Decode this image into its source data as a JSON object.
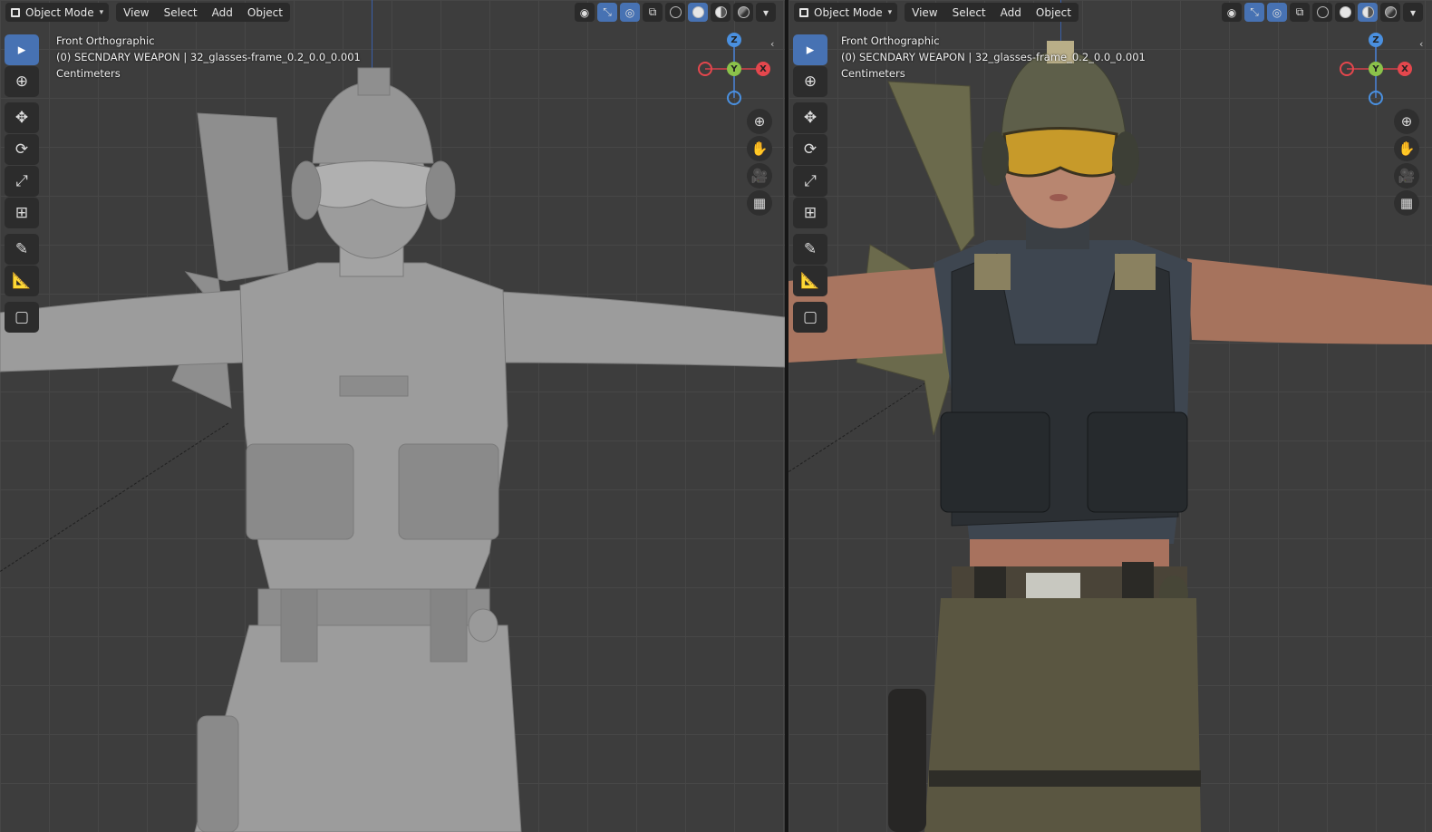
{
  "left_viewport": {
    "header": {
      "mode": "Object Mode",
      "menus": [
        "View",
        "Select",
        "Add",
        "Object"
      ]
    },
    "overlay": {
      "view_name": "Front Orthographic",
      "object_info": "(0) SECNDARY WEAPON | 32_glasses-frame_0.2_0.0_0.001",
      "units": "Centimeters"
    },
    "shading_mode": "solid",
    "scene_content": "character-solid-shaded"
  },
  "right_viewport": {
    "header": {
      "mode": "Object Mode",
      "menus": [
        "View",
        "Select",
        "Add",
        "Object"
      ]
    },
    "overlay": {
      "view_name": "Front Orthographic",
      "object_info": "(0) SECNDARY WEAPON | 32_glasses-frame_0.2_0.0_0.001",
      "units": "Centimeters"
    },
    "shading_mode": "material-preview",
    "scene_content": "character-textured"
  },
  "gizmo": {
    "z_label": "Z",
    "y_label": "Y",
    "x_label": "X",
    "colors": {
      "x": "#e5474d",
      "y": "#8bc24a",
      "z": "#4a90e0"
    }
  },
  "tools": [
    "select-box",
    "cursor",
    "move",
    "rotate",
    "scale",
    "transform",
    "annotate",
    "measure",
    "add-cube"
  ],
  "icons": {
    "select": "▸",
    "cursor": "⊕",
    "move": "✥",
    "rotate": "⟳",
    "scale": "⤢",
    "transform": "⊞",
    "annotate": "✎",
    "measure": "📐",
    "add_cube": "▢",
    "zoom": "⊕",
    "pan": "✋",
    "camera": "🎥",
    "grid": "▦",
    "collapse": "‹"
  },
  "theme": {
    "accent": "#4772b3",
    "viewport_bg": "#3d3d3d",
    "header_bg": "#2a2a2a"
  }
}
